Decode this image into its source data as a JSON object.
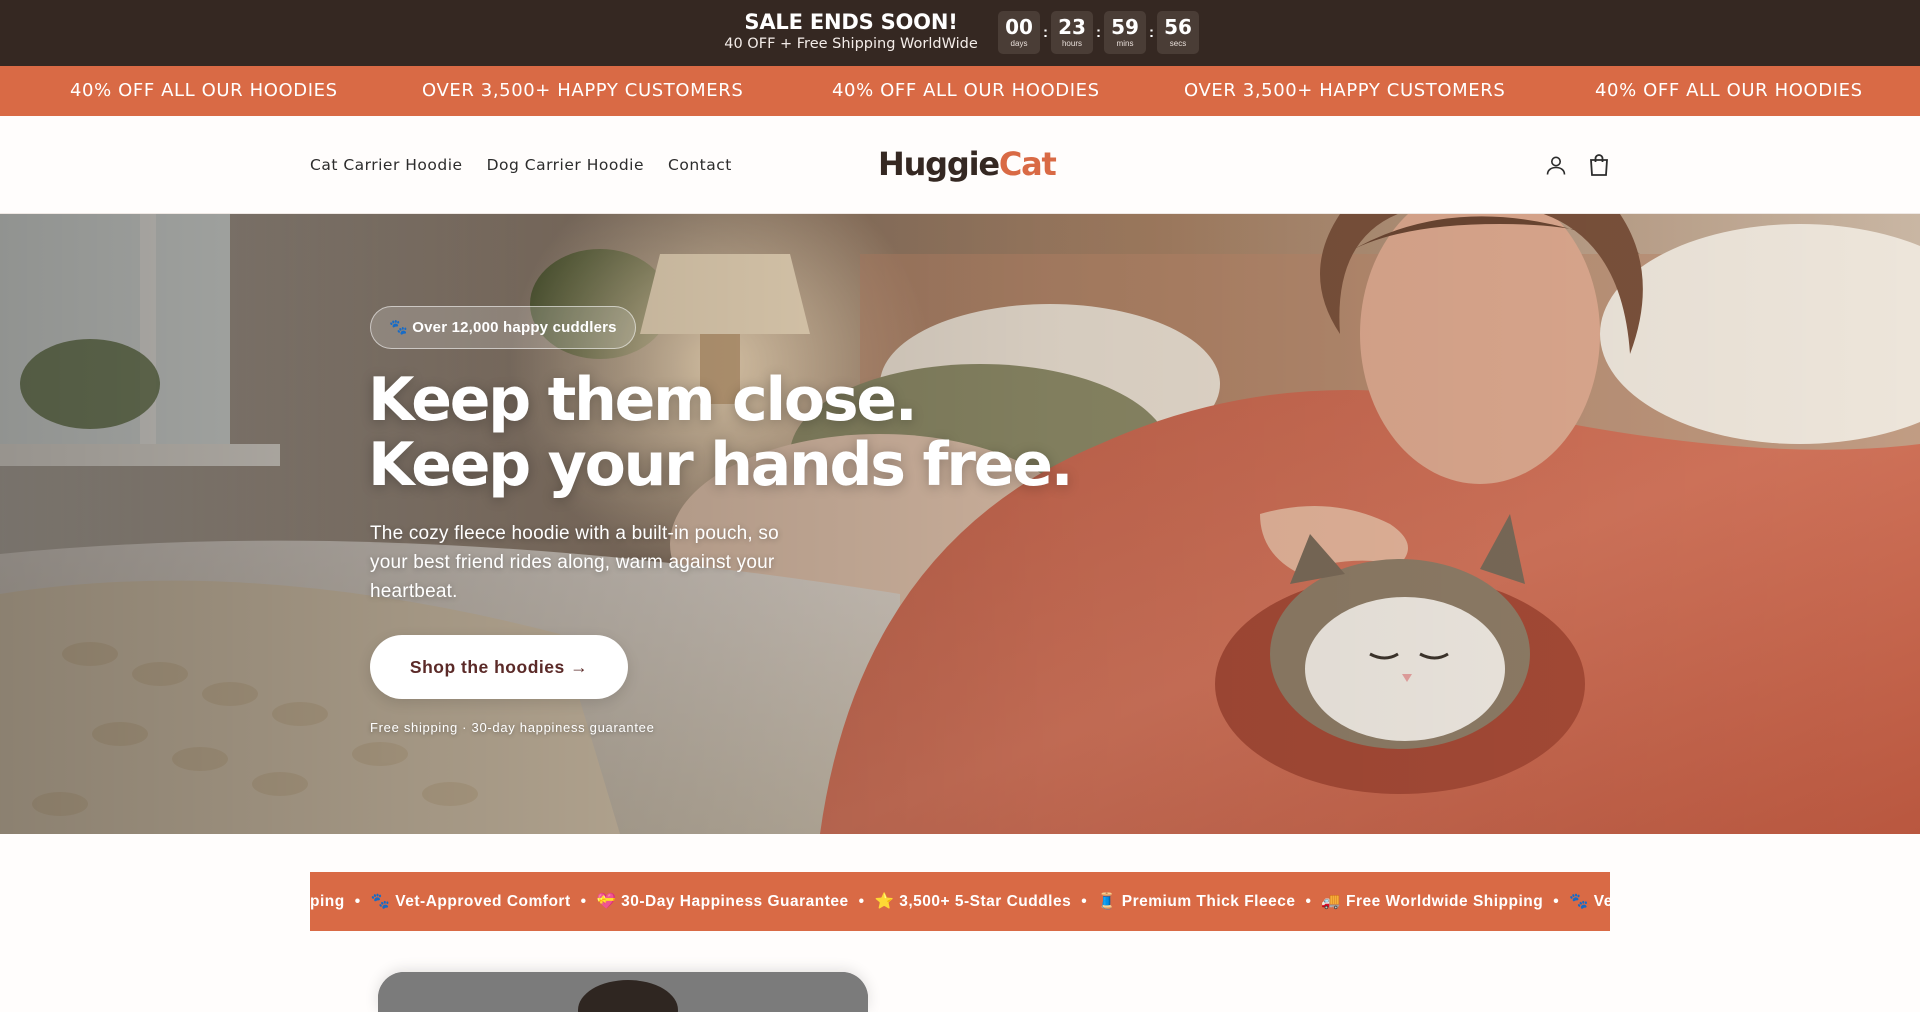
{
  "sale_bar": {
    "title": "SALE ENDS SOON!",
    "subtitle": "40 OFF + Free Shipping WorldWide",
    "countdown": [
      {
        "value": "00",
        "unit": "days"
      },
      {
        "value": "23",
        "unit": "hours"
      },
      {
        "value": "59",
        "unit": "mins"
      },
      {
        "value": "56",
        "unit": "secs"
      }
    ],
    "separator": ":"
  },
  "announcement": {
    "items": [
      "40% OFF ALL OUR HOODIES",
      "OVER 3,500+ HAPPY CUSTOMERS",
      "40% OFF ALL OUR HOODIES",
      "OVER 3,500+ HAPPY CUSTOMERS",
      "40% OFF ALL OUR HOODIES"
    ]
  },
  "header": {
    "nav": [
      "Cat Carrier Hoodie",
      "Dog Carrier Hoodie",
      "Contact"
    ],
    "logo_part1": "Huggie",
    "logo_part2": "Cat",
    "account_icon": "user-icon",
    "cart_icon": "shopping-bag-icon"
  },
  "hero": {
    "badge": "🐾 Over 12,000 happy cuddlers",
    "title_line1": "Keep them close.",
    "title_line2": "Keep your hands free.",
    "description": "The cozy fleece hoodie with a built-in pouch, so your best friend rides along, warm against your heartbeat.",
    "cta_label": "Shop the hoodies →",
    "footnote": "Free shipping · 30-day happiness guarantee"
  },
  "trust_strip": {
    "items": [
      "ping",
      "🐾 Vet-Approved Comfort",
      "💝 30-Day Happiness Guarantee",
      "⭐ 3,500+ 5-Star Cuddles",
      "🧵 Premium Thick Fleece",
      "🚚 Free Worldwide Shipping",
      "🐾 Ve"
    ],
    "separator": "•"
  },
  "colors": {
    "dark": "#352822",
    "accent": "#d96a45",
    "cta_text": "#5b2a28"
  }
}
